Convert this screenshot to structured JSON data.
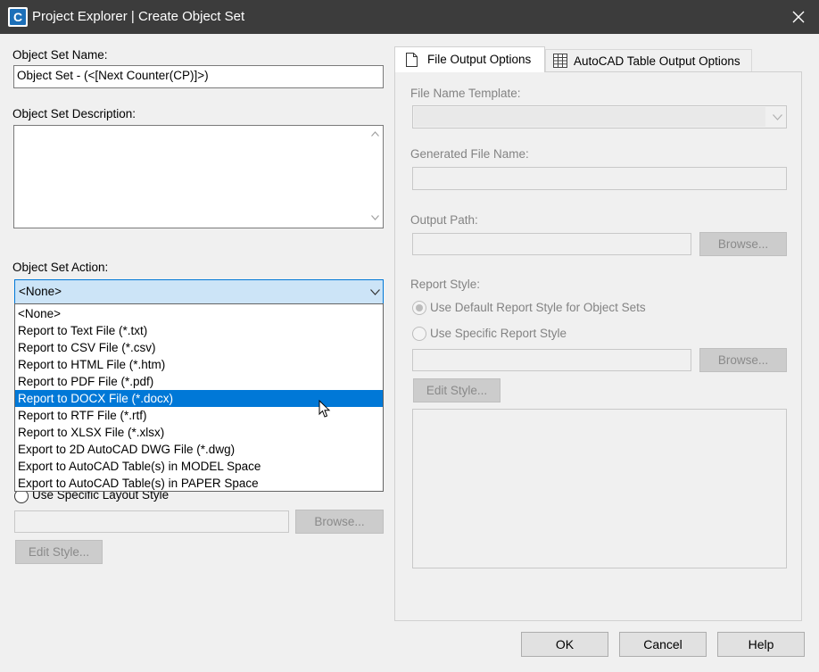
{
  "window": {
    "title": "Project Explorer | Create Object Set"
  },
  "left": {
    "name_label": "Object Set Name:",
    "name_value": "Object Set - (<[Next Counter(CP)]>)",
    "description_label": "Object Set Description:",
    "action_label": "Object Set Action:",
    "action_selected": "<None>",
    "action_options": [
      "<None>",
      "Report to Text File (*.txt)",
      "Report to CSV File (*.csv)",
      "Report to HTML File (*.htm)",
      "Report to PDF File (*.pdf)",
      "Report to DOCX File (*.docx)",
      "Report to RTF File (*.rtf)",
      "Report to XLSX File (*.xlsx)",
      "Export to 2D AutoCAD DWG File (*.dwg)",
      "Export to AutoCAD Table(s) in MODEL Space",
      "Export to AutoCAD Table(s) in PAPER Space"
    ],
    "highlighted_option": "Report to DOCX File (*.docx)",
    "specific_layout_label": "Use Specific Layout Style",
    "browse_label": "Browse...",
    "edit_style_label": "Edit Style..."
  },
  "tabs": [
    {
      "label": "File Output Options",
      "icon": "document-icon"
    },
    {
      "label": "AutoCAD Table Output Options",
      "icon": "table-icon"
    }
  ],
  "right": {
    "file_name_template_label": "File Name Template:",
    "generated_file_name_label": "Generated File Name:",
    "output_path_label": "Output Path:",
    "browse_label": "Browse...",
    "report_style_label": "Report Style:",
    "default_style_label": "Use Default Report Style for Object Sets",
    "specific_style_label": "Use Specific Report Style",
    "browse2_label": "Browse...",
    "edit_style_label": "Edit Style..."
  },
  "footer": {
    "ok": "OK",
    "cancel": "Cancel",
    "help": "Help"
  },
  "colors": {
    "titlebar": "#3c3c3c",
    "selection": "#0078d7",
    "combo_focus": "#cce4f7",
    "dialog": "#f0f0f0"
  }
}
